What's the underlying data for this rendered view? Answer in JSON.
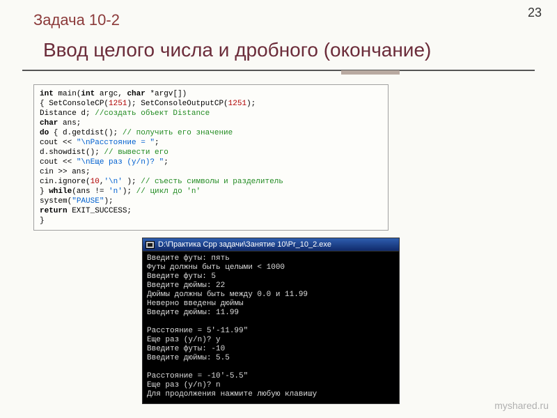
{
  "page_number": "23",
  "problem_label": "Задача 10-2",
  "title": "Ввод целого числа и дробного (окончание)",
  "code": {
    "l01a": "int",
    "l01b": " main(",
    "l01c": "int",
    "l01d": " argc, ",
    "l01e": "char",
    "l01f": " *argv[])",
    "l02a": "{   SetConsoleCP(",
    "l02b": "1251",
    "l02c": "); SetConsoleOutputCP(",
    "l02d": "1251",
    "l02e": ");",
    "l03a": "    Distance d;             ",
    "l03b": "//создать объект Distance",
    "l04a": "    ",
    "l04b": "char",
    "l04c": " ans;",
    "l05a": "    ",
    "l05b": "do",
    "l05c": " { d.getdist();         ",
    "l05d": "// получить его значение",
    "l06a": "         cout << ",
    "l06b": "\"\\nРасстояние = \"",
    "l06c": ";",
    "l07a": "         d.showdist();      ",
    "l07b": "// вывести его",
    "l08a": "         cout << ",
    "l08b": "\"\\nЕще раз (y/n)? \"",
    "l08c": ";",
    "l09a": "         cin >> ans;",
    "l10a": "         cin.ignore(",
    "l10b": "10",
    "l10c": ",",
    "l10d": "'\\n'",
    "l10e": " );",
    "l10f": " // съесть символы и разделитель",
    "l11a": "    } ",
    "l11b": "while",
    "l11c": "(ans != ",
    "l11d": "'n'",
    "l11e": "); ",
    "l11f": "// цикл до 'n'",
    "l12a": "    system(",
    "l12b": "\"PAUSE\"",
    "l12c": ");",
    "l13a": "    ",
    "l13b": "return",
    "l13c": " EXIT_SUCCESS;",
    "l14a": "}"
  },
  "console": {
    "title": "D:\\Практика Cpp задачи\\Занятие 10\\Pr_10_2.exe",
    "body": "Введите футы: пять\nФуты должны быть целыми < 1000\nВведите футы: 5\nВведите дюймы: 22\nДюймы должны быть между 0.0 и 11.99\nНеверно введены дюймы\nВведите дюймы: 11.99\n\nРасстояние = 5'-11.99\"\nЕще раз (y/n)? y\nВведите футы: -10\nВведите дюймы: 5.5\n\nРасстояние = -10'-5.5\"\nЕще раз (y/n)? n\nДля продолжения нажмите любую клавишу"
  },
  "watermark": "myshared.ru"
}
